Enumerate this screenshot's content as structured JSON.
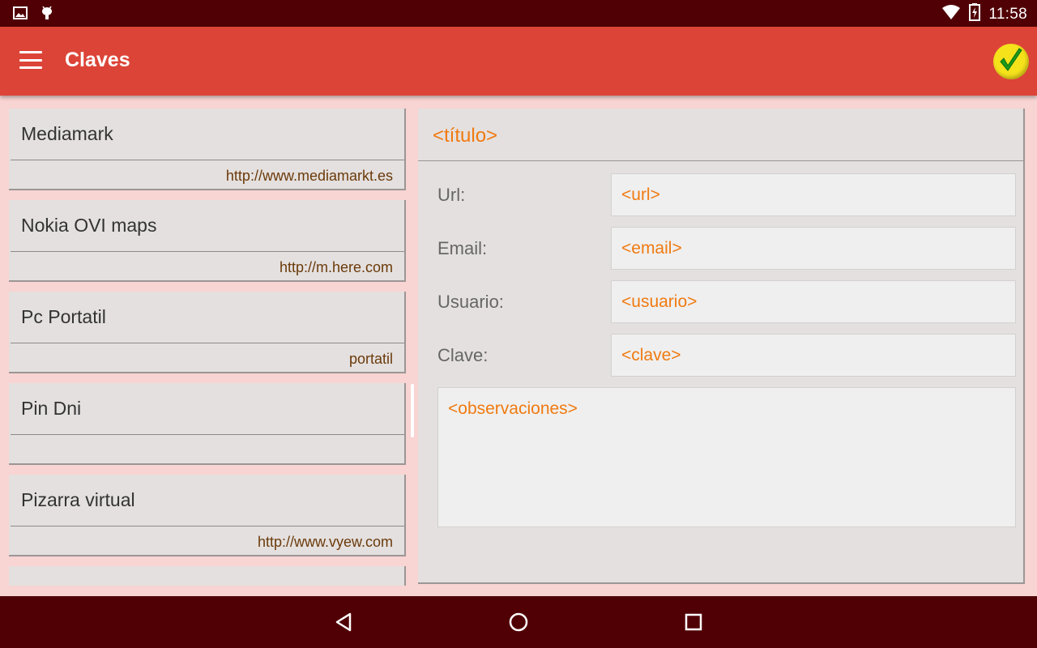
{
  "status_bar": {
    "time": "11:58",
    "icons": [
      "image-notification-icon",
      "android-debug-icon",
      "wifi-icon",
      "battery-charging-icon"
    ]
  },
  "app_bar": {
    "title": "Claves",
    "menu_icon": "hamburger-menu-icon",
    "action_icon": "checkmark-icon"
  },
  "list": {
    "items": [
      {
        "name": "Mediamark",
        "url": "http://www.mediamarkt.es"
      },
      {
        "name": "Nokia OVI maps",
        "url": "http://m.here.com"
      },
      {
        "name": "Pc Portatil",
        "url": "portatil"
      },
      {
        "name": "Pin Dni",
        "url": ""
      },
      {
        "name": "Pizarra virtual",
        "url": "http://www.vyew.com"
      }
    ]
  },
  "detail": {
    "title_placeholder": "<título>",
    "fields": [
      {
        "label": "Url:",
        "placeholder": "<url>"
      },
      {
        "label": "Email:",
        "placeholder": "<email>"
      },
      {
        "label": "Usuario:",
        "placeholder": "<usuario>"
      },
      {
        "label": "Clave:",
        "placeholder": "<clave>"
      }
    ],
    "notes_placeholder": "<observaciones>"
  },
  "nav_bar": {
    "icons": [
      "back-icon",
      "home-icon",
      "recents-icon"
    ]
  },
  "colors": {
    "status_bar": "#500005",
    "app_bar": "#dc4437",
    "background": "#f8d4d2",
    "accent": "#f07a10",
    "url_text": "#6b3a0a"
  }
}
